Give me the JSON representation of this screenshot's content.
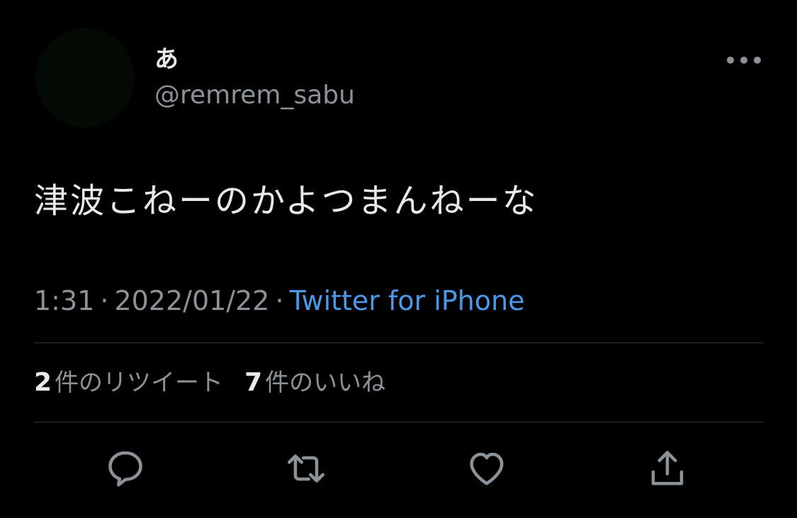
{
  "user": {
    "display_name": "あ",
    "handle": "@remrem_sabu"
  },
  "tweet": {
    "text": "津波こねーのかよつまんねーな",
    "time": "1:31",
    "date": "2022/01/22",
    "separator": "·",
    "source": "Twitter for iPhone"
  },
  "stats": {
    "retweets_count": "2",
    "retweets_label": "件のリツイート",
    "likes_count": "7",
    "likes_label": "件のいいね"
  },
  "actions": {
    "reply_icon": "reply-icon",
    "retweet_icon": "retweet-icon",
    "like_icon": "heart-icon",
    "share_icon": "share-icon"
  },
  "colors": {
    "background": "#000000",
    "text_primary": "#e7e9ea",
    "text_secondary": "#8b9298",
    "link": "#4a99e9",
    "divider": "#2f3336"
  }
}
